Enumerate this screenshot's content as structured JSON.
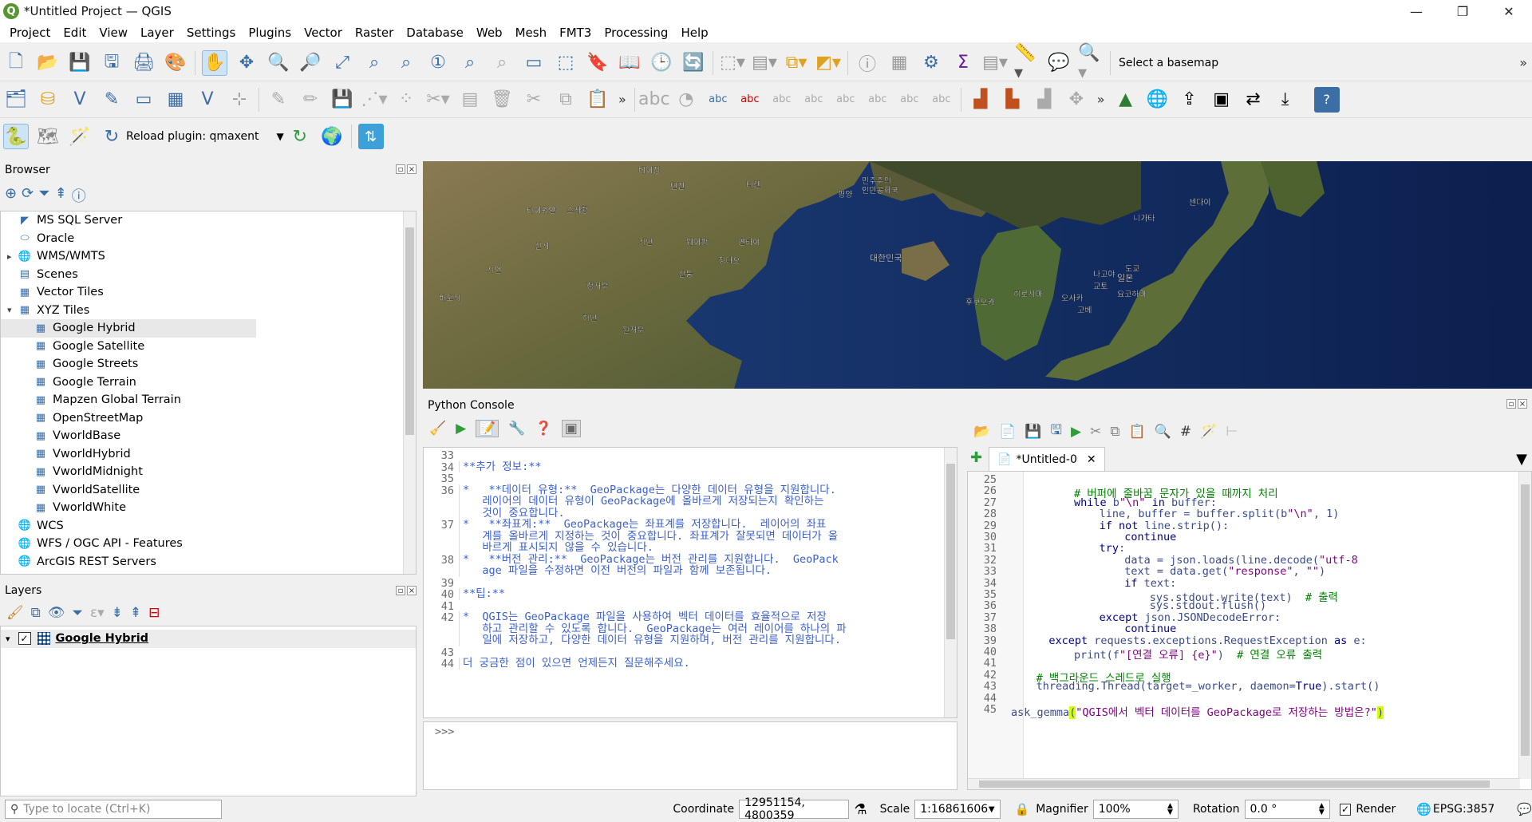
{
  "window": {
    "title": "*Untitled Project — QGIS",
    "logo": "Q",
    "minimize": "—",
    "maximize": "❐",
    "close": "✕"
  },
  "menu": [
    "Project",
    "Edit",
    "View",
    "Layer",
    "Settings",
    "Plugins",
    "Vector",
    "Raster",
    "Database",
    "Web",
    "Mesh",
    "FMT3",
    "Processing",
    "Help"
  ],
  "toolbar": {
    "basemap_label": "Select a basemap",
    "reload_plugin": "Reload plugin: qmaxent"
  },
  "browser": {
    "title": "Browser",
    "items": [
      {
        "label": "MS SQL Server",
        "indent": 0,
        "icon": "mssql-icon"
      },
      {
        "label": "Oracle",
        "indent": 0,
        "icon": "oracle-icon"
      },
      {
        "label": "WMS/WMTS",
        "indent": 0,
        "icon": "globe-icon",
        "expander": "▸"
      },
      {
        "label": "Scenes",
        "indent": 0,
        "icon": "scenes-icon"
      },
      {
        "label": "Vector Tiles",
        "indent": 0,
        "icon": "grid-icon"
      },
      {
        "label": "XYZ Tiles",
        "indent": 0,
        "icon": "grid-icon",
        "expander": "▾"
      },
      {
        "label": "Google Hybrid",
        "indent": 1,
        "icon": "grid-icon",
        "selected": true
      },
      {
        "label": "Google Satellite",
        "indent": 1,
        "icon": "grid-icon"
      },
      {
        "label": "Google Streets",
        "indent": 1,
        "icon": "grid-icon"
      },
      {
        "label": "Google Terrain",
        "indent": 1,
        "icon": "grid-icon"
      },
      {
        "label": "Mapzen Global Terrain",
        "indent": 1,
        "icon": "grid-icon"
      },
      {
        "label": "OpenStreetMap",
        "indent": 1,
        "icon": "grid-icon"
      },
      {
        "label": "VworldBase",
        "indent": 1,
        "icon": "grid-icon"
      },
      {
        "label": "VworldHybrid",
        "indent": 1,
        "icon": "grid-icon"
      },
      {
        "label": "VworldMidnight",
        "indent": 1,
        "icon": "grid-icon"
      },
      {
        "label": "VworldSatellite",
        "indent": 1,
        "icon": "grid-icon"
      },
      {
        "label": "VworldWhite",
        "indent": 1,
        "icon": "grid-icon"
      },
      {
        "label": "WCS",
        "indent": 0,
        "icon": "globe-icon"
      },
      {
        "label": "WFS / OGC API - Features",
        "indent": 0,
        "icon": "globe-icon"
      },
      {
        "label": "ArcGIS REST Servers",
        "indent": 0,
        "icon": "globe-icon"
      }
    ]
  },
  "layers": {
    "title": "Layers",
    "items": [
      {
        "label": "Google Hybrid",
        "checked": true
      }
    ]
  },
  "map": {
    "labels": [
      {
        "t": "민주주의\n인민공화국"
      },
      {
        "t": "대한민국"
      },
      {
        "t": "일본"
      },
      {
        "t": "베이징"
      },
      {
        "t": "톈진"
      },
      {
        "t": "다롄"
      },
      {
        "t": "칭다오"
      },
      {
        "t": "평양"
      },
      {
        "t": "도쿄"
      },
      {
        "t": "오사카"
      },
      {
        "t": "후쿠오카"
      },
      {
        "t": "히로시마"
      },
      {
        "t": "센다이"
      },
      {
        "t": "니가타"
      },
      {
        "t": "나고야"
      },
      {
        "t": "요코하마"
      },
      {
        "t": "타이위안"
      },
      {
        "t": "스자좡"
      },
      {
        "t": "지난"
      },
      {
        "t": "정저우"
      },
      {
        "t": "옌타이"
      },
      {
        "t": "웨이팡"
      },
      {
        "t": "시안"
      },
      {
        "t": "바오지"
      },
      {
        "t": "고베"
      },
      {
        "t": "교토"
      },
      {
        "t": "원저우"
      },
      {
        "t": "허난"
      },
      {
        "t": "산시"
      },
      {
        "t": "산둥"
      }
    ]
  },
  "console": {
    "title": "Python Console",
    "prompt": ">>>",
    "output": [
      {
        "n": "33",
        "text": ""
      },
      {
        "n": "34",
        "text": "**추가 정보:**"
      },
      {
        "n": "35",
        "text": ""
      },
      {
        "n": "36",
        "text": "*   **데이터 유형:**  GeoPackage는 다양한 데이터 유형을 지원합니다.\n   레이어의 데이터 유형이 GeoPackage에 올바르게 저장되는지 확인하는\n   것이 중요합니다."
      },
      {
        "n": "37",
        "text": "*   **좌표계:**  GeoPackage는 좌표계를 저장합니다.  레이어의 좌표\n   계를 올바르게 지정하는 것이 중요합니다. 좌표계가 잘못되면 데이터가 올\n   바르게 표시되지 않을 수 있습니다."
      },
      {
        "n": "38",
        "text": "*   **버전 관리:**  GeoPackage는 버전 관리를 지원합니다.  GeoPack\n   age 파일을 수정하면 이전 버전의 파일과 함께 보존됩니다."
      },
      {
        "n": "39",
        "text": ""
      },
      {
        "n": "40",
        "text": "**팁:**"
      },
      {
        "n": "41",
        "text": ""
      },
      {
        "n": "42",
        "text": "*  QGIS는 GeoPackage 파일을 사용하여 벡터 데이터를 효율적으로 저장\n   하고 관리할 수 있도록 합니다.  GeoPackage는 여러 레이어를 하나의 파\n   일에 저장하고, 다양한 데이터 유형을 지원하며, 버전 관리를 지원합니다."
      },
      {
        "n": "43",
        "text": ""
      },
      {
        "n": "44",
        "text": "더 궁금한 점이 있으면 언제든지 질문해주세요."
      }
    ],
    "editor_tab": "*Untitled-0",
    "editor": [
      {
        "n": "25",
        "ind": 0,
        "html": ""
      },
      {
        "n": "26",
        "ind": 10,
        "html": "<span class='cm'># 버퍼에 줄바꿈 문자가 있을 때까지 처리</span>"
      },
      {
        "n": "27",
        "ind": 10,
        "html": "<span class='kw'>while</span> b<span class='str'>\"\\n\"</span> <span class='kw'>in</span> buffer:"
      },
      {
        "n": "28",
        "ind": 14,
        "html": "line, buffer = buffer.split(b<span class='str'>\"\\n\"</span>, 1)"
      },
      {
        "n": "29",
        "ind": 14,
        "html": "<span class='kw'>if not</span> line.strip():"
      },
      {
        "n": "30",
        "ind": 18,
        "html": "<span class='kw'>continue</span>"
      },
      {
        "n": "31",
        "ind": 14,
        "html": "<span class='kw'>try</span>:"
      },
      {
        "n": "32",
        "ind": 18,
        "html": "data = json.loads(line.decode(<span class='str'>\"utf-8</span>"
      },
      {
        "n": "33",
        "ind": 18,
        "html": "text = data.get(<span class='str'>\"response\"</span>, <span class='str'>\"\"</span>)"
      },
      {
        "n": "34",
        "ind": 18,
        "html": "<span class='kw'>if</span> text:"
      },
      {
        "n": "35",
        "ind": 22,
        "html": "sys.stdout.write(text)  <span class='cm'># 출력</span>"
      },
      {
        "n": "36",
        "ind": 22,
        "html": "sys.stdout.flush()"
      },
      {
        "n": "37",
        "ind": 14,
        "html": "<span class='kw'>except</span> json.JSONDecodeError:"
      },
      {
        "n": "38",
        "ind": 18,
        "html": "<span class='kw'>continue</span>"
      },
      {
        "n": "39",
        "ind": 6,
        "html": "<span class='kw'>except</span> requests.exceptions.RequestException <span class='kw'>as</span> e:"
      },
      {
        "n": "40",
        "ind": 10,
        "html": "print(f<span class='str'>\"[연결 오류] {e}\"</span>)  <span class='cm'># 연결 오류 출력</span>"
      },
      {
        "n": "41",
        "ind": 0,
        "html": ""
      },
      {
        "n": "42",
        "ind": 4,
        "html": "<span class='cm'># 백그라운드 스레드로 실행</span>"
      },
      {
        "n": "43",
        "ind": 4,
        "html": "threading.Thread(target=_worker, daemon=<span class='kw'>True</span>).start()"
      },
      {
        "n": "44",
        "ind": 0,
        "html": ""
      },
      {
        "n": "45",
        "ind": 0,
        "html": "ask_gemma<span style='background:#d4ff00'>(</span><span class='str'>\"QGIS에서 벡터 데이터를 GeoPackage로 저장하는 방법은?\"</span><span style='background:#d4ff00'>)</span>"
      }
    ]
  },
  "statusbar": {
    "locate_placeholder": "Type to locate (Ctrl+K)",
    "coordinate_label": "Coordinate",
    "coordinate_value": "12951154, 4800359",
    "scale_label": "Scale",
    "scale_value": "1:16861606",
    "magnifier_label": "Magnifier",
    "magnifier_value": "100%",
    "rotation_label": "Rotation",
    "rotation_value": "0.0 °",
    "render_label": "Render",
    "crs": "EPSG:3857"
  }
}
